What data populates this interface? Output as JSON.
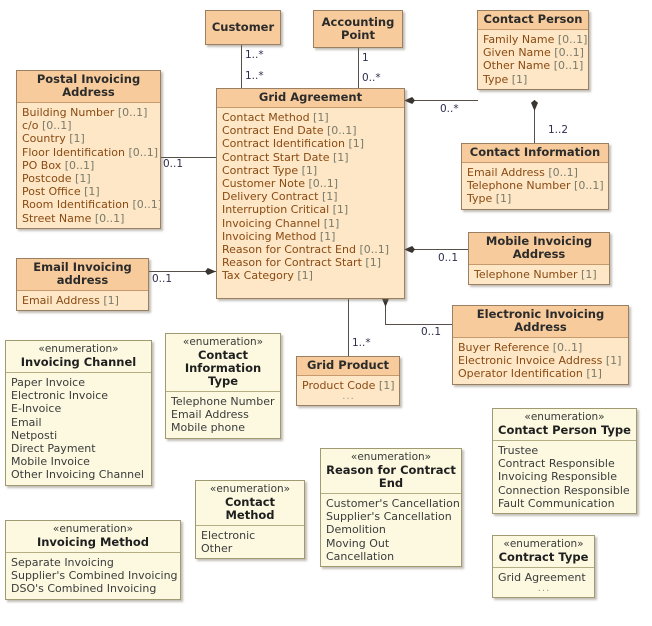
{
  "diagram": {
    "title": "Grid Agreement UML class diagram",
    "colors": {
      "class_header": "#f7cb9b",
      "class_body": "#fde7c6",
      "enum_fill": "#fcf9e0",
      "border": "#9a7f63",
      "line": "#555049",
      "attribute_text": "#8a4a13",
      "multiplicity_text": "#2e2e4e"
    },
    "stereotype_enumeration": "«enumeration»",
    "ellipsis": "..."
  },
  "classes": {
    "customer": {
      "name": "Customer",
      "attributes": []
    },
    "accounting_point": {
      "name": "Accounting Point",
      "attributes": []
    },
    "contact_person": {
      "name": "Contact Person",
      "attributes": [
        {
          "label": "Family Name",
          "mult": "[0..1]"
        },
        {
          "label": "Given Name",
          "mult": "[0..1]"
        },
        {
          "label": "Other Name",
          "mult": "[0..1]"
        },
        {
          "label": "Type",
          "mult": "[1]"
        }
      ]
    },
    "contact_information": {
      "name": "Contact Information",
      "attributes": [
        {
          "label": "Email Address",
          "mult": "[0..1]"
        },
        {
          "label": "Telephone Number",
          "mult": "[0..1]"
        },
        {
          "label": "Type",
          "mult": "[1]"
        }
      ]
    },
    "postal_invoicing_address": {
      "name": "Postal Invoicing Address",
      "attributes": [
        {
          "label": "Building Number",
          "mult": "[0..1]"
        },
        {
          "label": "c/o",
          "mult": "[0..1]"
        },
        {
          "label": "Country",
          "mult": "[1]"
        },
        {
          "label": "Floor Identification",
          "mult": "[0..1]"
        },
        {
          "label": "PO Box",
          "mult": "[0..1]"
        },
        {
          "label": "Postcode",
          "mult": "[1]"
        },
        {
          "label": "Post Office",
          "mult": "[1]"
        },
        {
          "label": "Room Identification",
          "mult": "[0..1]"
        },
        {
          "label": "Street Name",
          "mult": "[0..1]"
        }
      ]
    },
    "email_invoicing_address": {
      "name": "Email Invoicing address",
      "attributes": [
        {
          "label": "Email Address",
          "mult": "[1]"
        }
      ]
    },
    "grid_agreement": {
      "name": "Grid Agreement",
      "attributes": [
        {
          "label": "Contact Method",
          "mult": "[1]"
        },
        {
          "label": "Contract End Date",
          "mult": "[0..1]"
        },
        {
          "label": "Contract Identification",
          "mult": "[1]"
        },
        {
          "label": "Contract Start Date",
          "mult": "[1]"
        },
        {
          "label": "Contract Type",
          "mult": "[1]"
        },
        {
          "label": "Customer Note",
          "mult": "[0..1]"
        },
        {
          "label": "Delivery Contract",
          "mult": "[1]"
        },
        {
          "label": "Interruption Critical",
          "mult": "[1]"
        },
        {
          "label": "Invoicing Channel",
          "mult": "[1]"
        },
        {
          "label": "Invoicing Method",
          "mult": "[1]"
        },
        {
          "label": "Reason for Contract End",
          "mult": "[0..1]"
        },
        {
          "label": "Reason for Contract Start",
          "mult": "[1]"
        },
        {
          "label": "Tax Category",
          "mult": "[1]"
        }
      ]
    },
    "mobile_invoicing_address": {
      "name": "Mobile Invoicing Address",
      "attributes": [
        {
          "label": "Telephone Number",
          "mult": "[1]"
        }
      ]
    },
    "electronic_invoicing_address": {
      "name": "Electronic Invoicing Address",
      "attributes": [
        {
          "label": "Buyer Reference",
          "mult": "[0..1]"
        },
        {
          "label": "Electronic Invoice Address",
          "mult": "[1]"
        },
        {
          "label": "Operator Identification",
          "mult": "[1]"
        }
      ]
    },
    "grid_product": {
      "name": "Grid Product",
      "attributes": [
        {
          "label": "Product Code",
          "mult": "[1]"
        }
      ],
      "has_ellipsis": true
    }
  },
  "enumerations": {
    "invoicing_channel": {
      "stereotype": "«enumeration»",
      "name": "Invoicing Channel",
      "literals": [
        "Paper Invoice",
        "Electronic Invoice",
        "E-Invoice",
        "Email",
        "Netposti",
        "Direct Payment",
        "Mobile Invoice",
        "Other Invoicing Channel"
      ]
    },
    "contact_information_type": {
      "stereotype": "«enumeration»",
      "name": "Contact Information Type",
      "literals": [
        "Telephone Number",
        "Email Address",
        "Mobile phone"
      ]
    },
    "invoicing_method": {
      "stereotype": "«enumeration»",
      "name": "Invoicing Method",
      "literals": [
        "Separate Invoicing",
        "Supplier's Combined Invoicing",
        "DSO's Combined Invoicing"
      ]
    },
    "contact_method": {
      "stereotype": "«enumeration»",
      "name": "Contact Method",
      "literals": [
        "Electronic",
        "Other"
      ]
    },
    "reason_for_contract_end": {
      "stereotype": "«enumeration»",
      "name": "Reason for Contract End",
      "literals": [
        "Customer's Cancellation",
        "Supplier's Cancellation",
        "Demolition",
        "Moving Out",
        "Cancellation"
      ]
    },
    "contact_person_type": {
      "stereotype": "«enumeration»",
      "name": "Contact Person Type",
      "literals": [
        "Trustee",
        "Contract Responsible",
        "Invoicing Responsible",
        "Connection Responsible",
        "Fault Communication"
      ]
    },
    "contract_type": {
      "stereotype": "«enumeration»",
      "name": "Contract Type",
      "literals": [
        "Grid Agreement"
      ],
      "has_ellipsis": true
    }
  },
  "multiplicities": {
    "customer_to_grid_top": "1..*",
    "customer_to_grid_bottom": "1..*",
    "accounting_point_top": "1",
    "accounting_point_bottom": "0..*",
    "postal_to_grid": "0..1",
    "email_to_grid": "0..1",
    "grid_to_contact_person": "0..*",
    "contact_person_to_contact_info": "1..2",
    "grid_to_mobile": "0..1",
    "grid_to_electronic": "0..1",
    "grid_to_product": "1..*"
  }
}
